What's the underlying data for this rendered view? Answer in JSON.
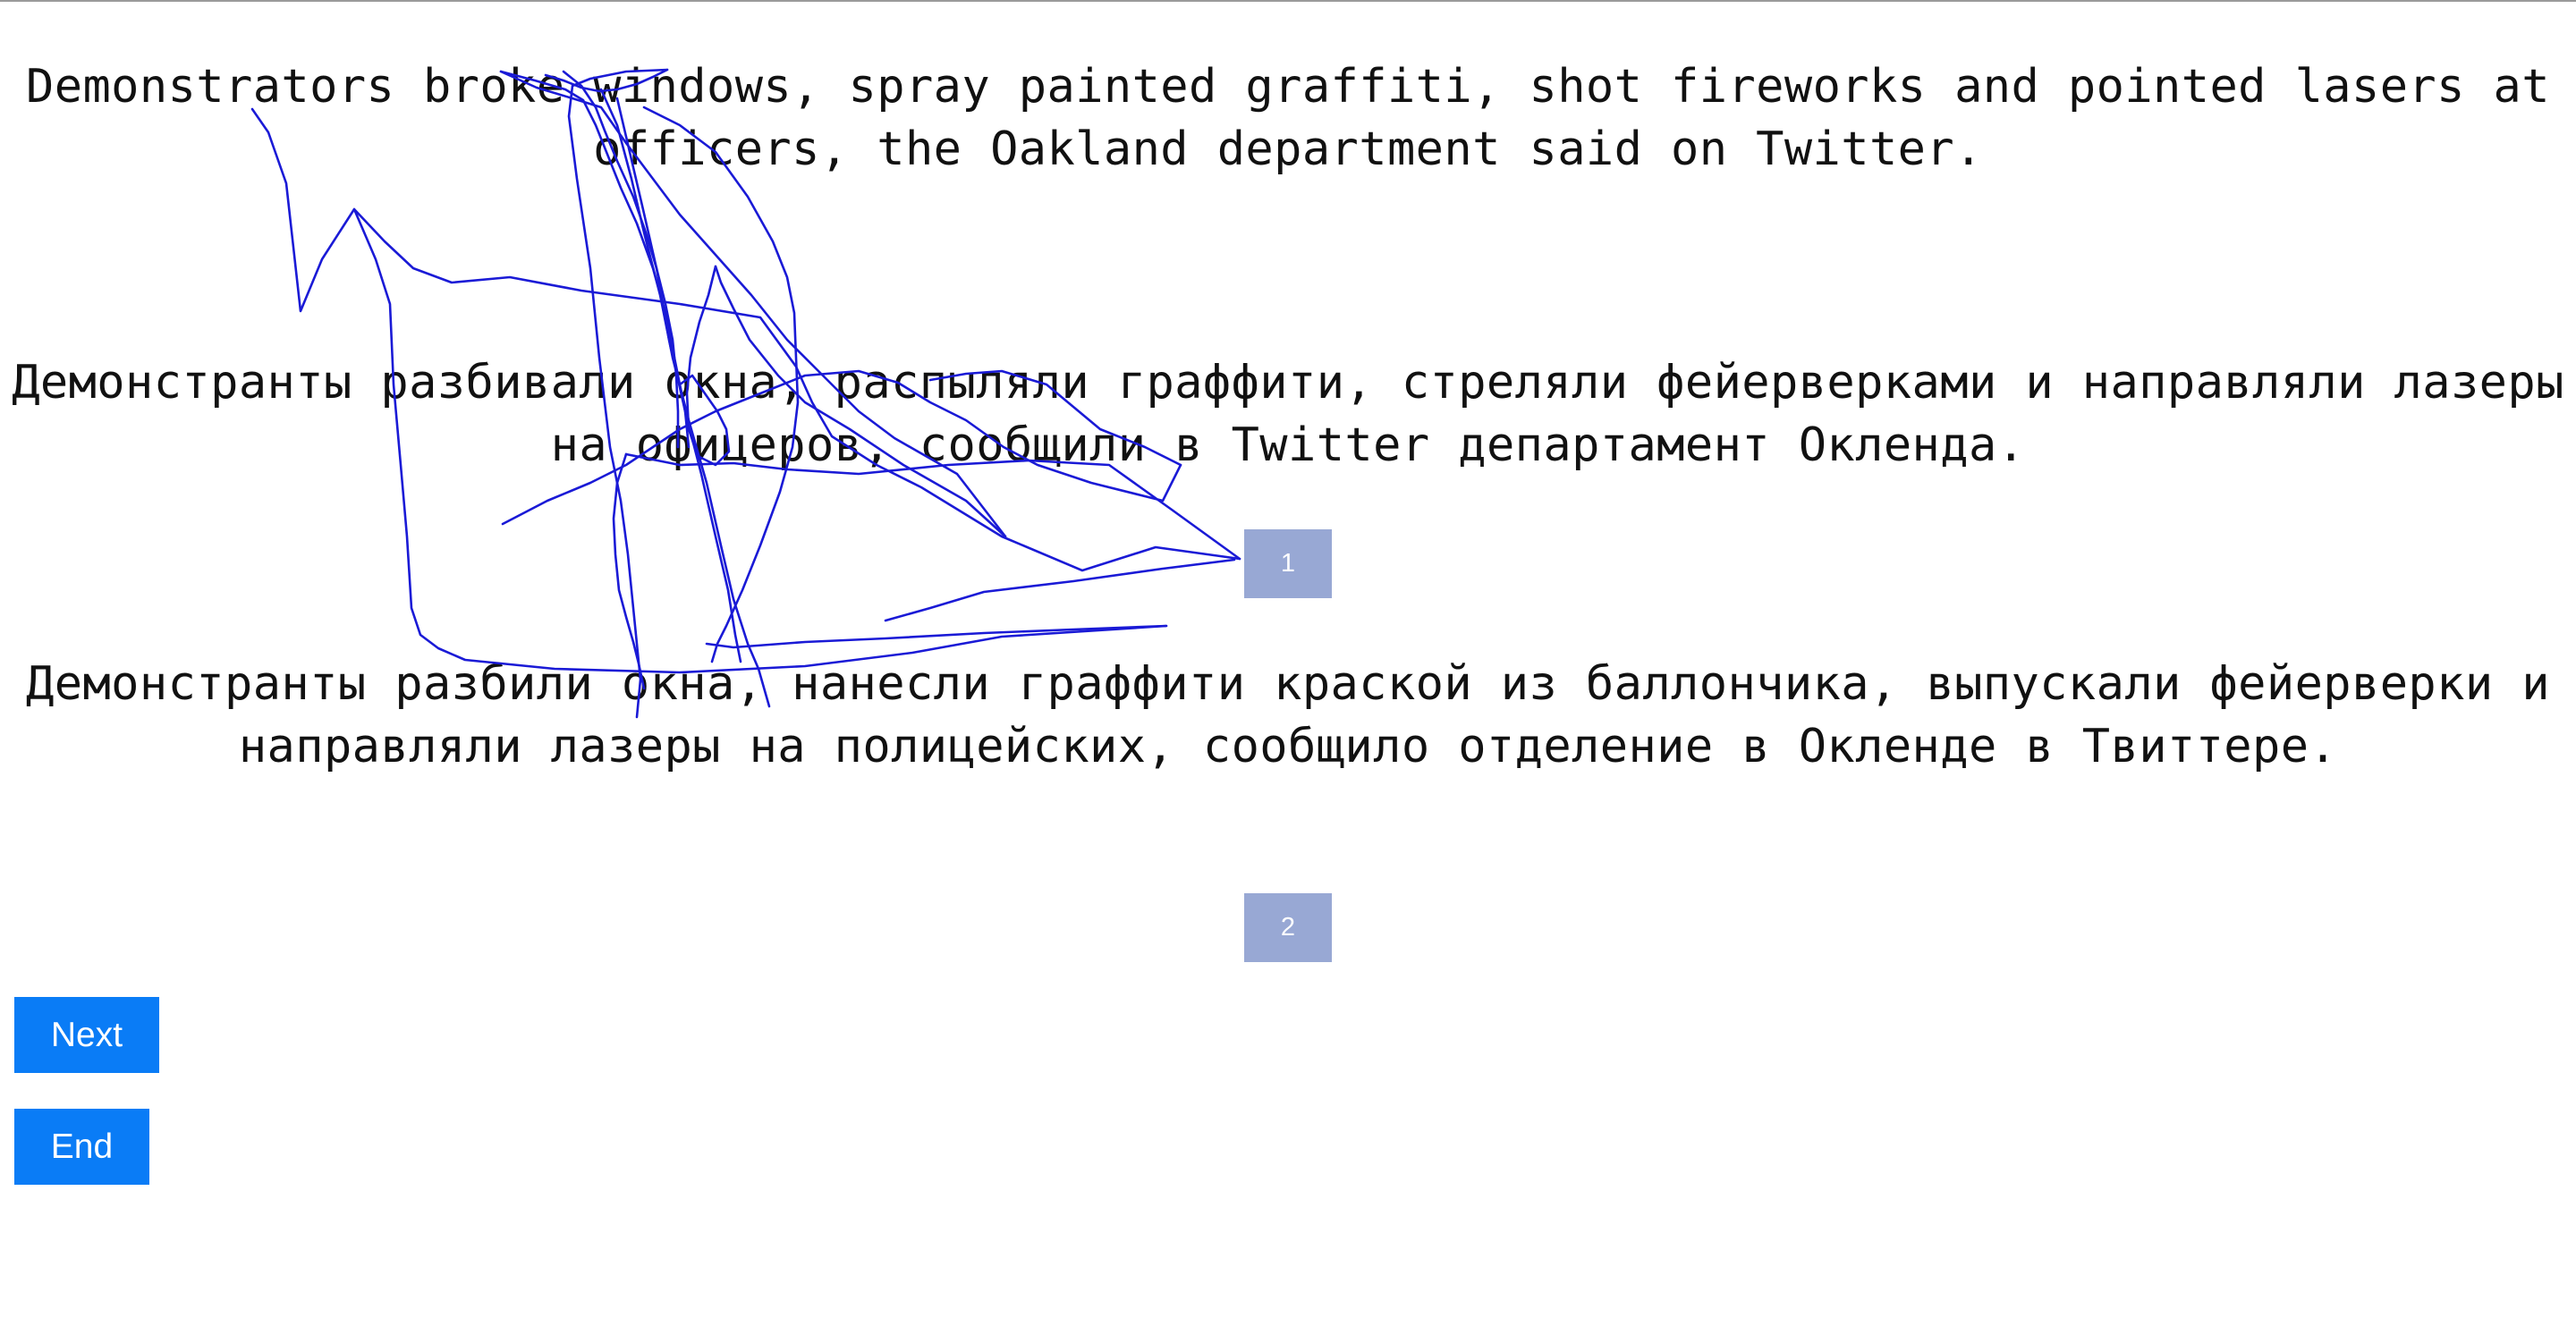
{
  "source": {
    "text": "Demonstrators broke windows, spray painted graffiti, shot fireworks and pointed lasers at officers, the Oakland department said on Twitter."
  },
  "translations": [
    {
      "text": "Демонстранты разбивали окна, распыляли граффити, стреляли фейерверками и направляли лазеры на офицеров, сообщили в Twitter департамент Окленда.",
      "rank_label": "1"
    },
    {
      "text": "Демонстранты разбили окна, нанесли граффити краской из баллончика, выпускали фейерверки и направляли лазеры на полицейских, сообщило отделение в Окленде в Твиттере.",
      "rank_label": "2"
    }
  ],
  "buttons": {
    "next_label": "Next",
    "end_label": "End"
  },
  "colors": {
    "rank_box": "#98a8d4",
    "button": "#0a7cf6",
    "ink_stroke": "#1a1ad6"
  }
}
